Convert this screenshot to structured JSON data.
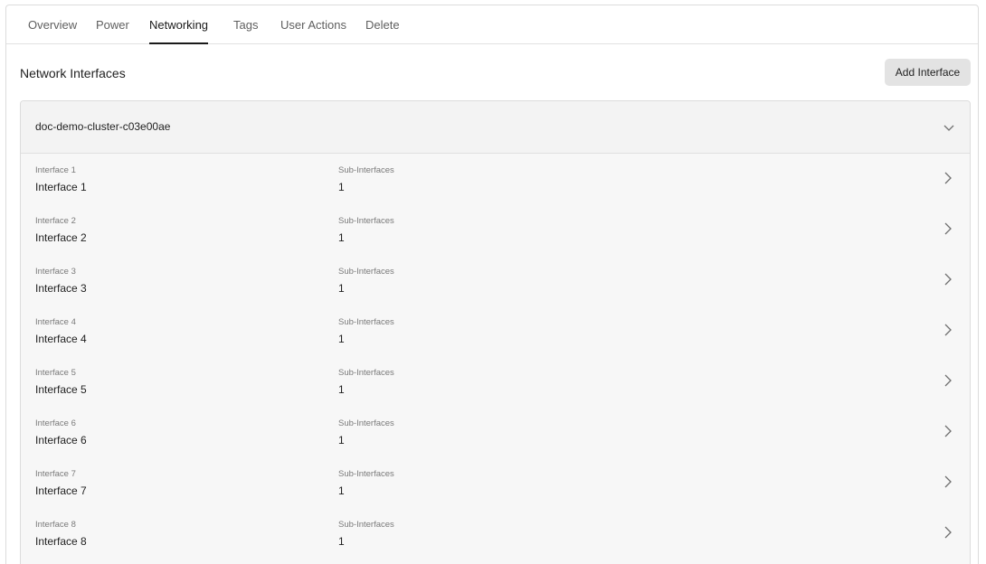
{
  "tabs": [
    "Overview",
    "Power",
    "Networking",
    "Tags",
    "User Actions",
    "Delete"
  ],
  "active_tab": "Networking",
  "section": {
    "title": "Network Interfaces",
    "add_button": "Add Interface"
  },
  "cluster": {
    "name": "doc-demo-cluster-c03e00ae",
    "expand_icon": "chevron-down-icon",
    "row_icon": "chevron-right-icon",
    "interfaces": [
      {
        "label": "Interface 1",
        "value": "Interface 1",
        "sub_label": "Sub-Interfaces",
        "sub_value": "1"
      },
      {
        "label": "Interface 2",
        "value": "Interface 2",
        "sub_label": "Sub-Interfaces",
        "sub_value": "1"
      },
      {
        "label": "Interface 3",
        "value": "Interface 3",
        "sub_label": "Sub-Interfaces",
        "sub_value": "1"
      },
      {
        "label": "Interface 4",
        "value": "Interface 4",
        "sub_label": "Sub-Interfaces",
        "sub_value": "1"
      },
      {
        "label": "Interface 5",
        "value": "Interface 5",
        "sub_label": "Sub-Interfaces",
        "sub_value": "1"
      },
      {
        "label": "Interface 6",
        "value": "Interface 6",
        "sub_label": "Sub-Interfaces",
        "sub_value": "1"
      },
      {
        "label": "Interface 7",
        "value": "Interface 7",
        "sub_label": "Sub-Interfaces",
        "sub_value": "1"
      },
      {
        "label": "Interface 8",
        "value": "Interface 8",
        "sub_label": "Sub-Interfaces",
        "sub_value": "1"
      }
    ]
  },
  "colors": {
    "accent": "#1a1a1a",
    "button_bg": "#e3e3e3",
    "panel_bg": "#f7f7f7",
    "border": "#dcdcdc"
  }
}
